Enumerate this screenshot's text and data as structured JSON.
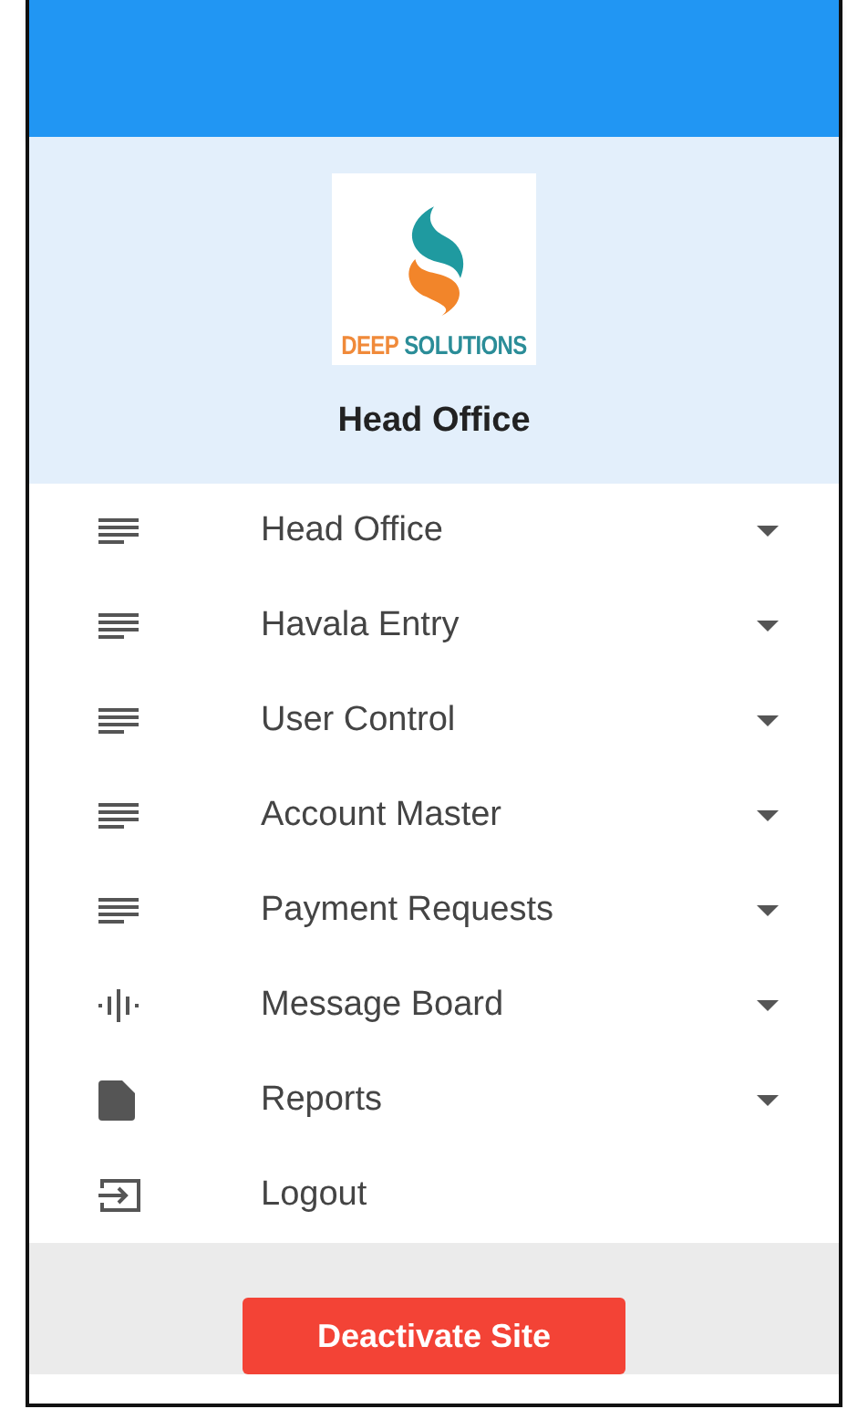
{
  "logo": {
    "words": [
      "DEEP",
      "SOLUTIONS"
    ]
  },
  "office": "Head Office",
  "menu": [
    {
      "label": "Head Office",
      "kind": "lines",
      "expandable": true
    },
    {
      "label": "Havala Entry",
      "kind": "lines",
      "expandable": true
    },
    {
      "label": "User Control",
      "kind": "lines",
      "expandable": true
    },
    {
      "label": "Account Master",
      "kind": "lines",
      "expandable": true
    },
    {
      "label": "Payment Requests",
      "kind": "lines",
      "expandable": true
    },
    {
      "label": "Message Board",
      "kind": "wave",
      "expandable": true
    },
    {
      "label": "Reports",
      "kind": "file",
      "expandable": true
    },
    {
      "label": "Logout",
      "kind": "logout",
      "expandable": false
    }
  ],
  "footer_button": "Deactivate Site"
}
